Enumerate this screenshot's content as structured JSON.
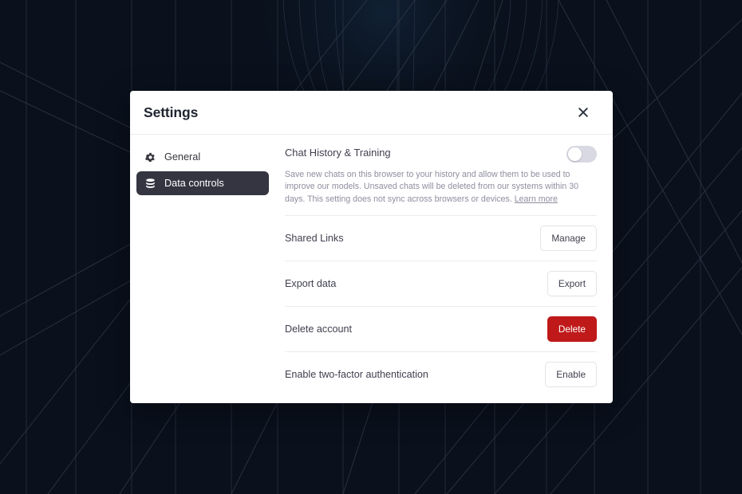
{
  "background": {
    "base_color": "#0a111d",
    "line_color": "#28313f",
    "accent_glow": "#0d1a2b"
  },
  "modal": {
    "title": "Settings",
    "close_icon": "close-icon",
    "sidebar": {
      "items": [
        {
          "label": "General",
          "icon": "gear-icon",
          "active": false
        },
        {
          "label": "Data controls",
          "icon": "database-icon",
          "active": true
        }
      ],
      "active_background": "#343541"
    },
    "content": {
      "chat_history": {
        "heading": "Chat History & Training",
        "description": "Save new chats on this browser to your history and allow them to be used to improve our models. Unsaved chats will be deleted from our systems within 30 days. This setting does not sync across browsers or devices.",
        "learn_more_label": "Learn more",
        "toggle": {
          "name": "chat-history-toggle",
          "state": "off",
          "track_color": "#d9d9e3",
          "knob_color": "#ffffff"
        }
      },
      "rows": [
        {
          "label": "Shared Links",
          "button_label": "Manage",
          "style": "secondary"
        },
        {
          "label": "Export data",
          "button_label": "Export",
          "style": "secondary"
        },
        {
          "label": "Delete account",
          "button_label": "Delete",
          "style": "danger"
        },
        {
          "label": "Enable two-factor authentication",
          "button_label": "Enable",
          "style": "secondary"
        }
      ]
    }
  },
  "colors": {
    "danger": "#c01919",
    "text_primary": "#40414f",
    "text_muted": "#8e8ea0",
    "divider": "#ececf1"
  }
}
